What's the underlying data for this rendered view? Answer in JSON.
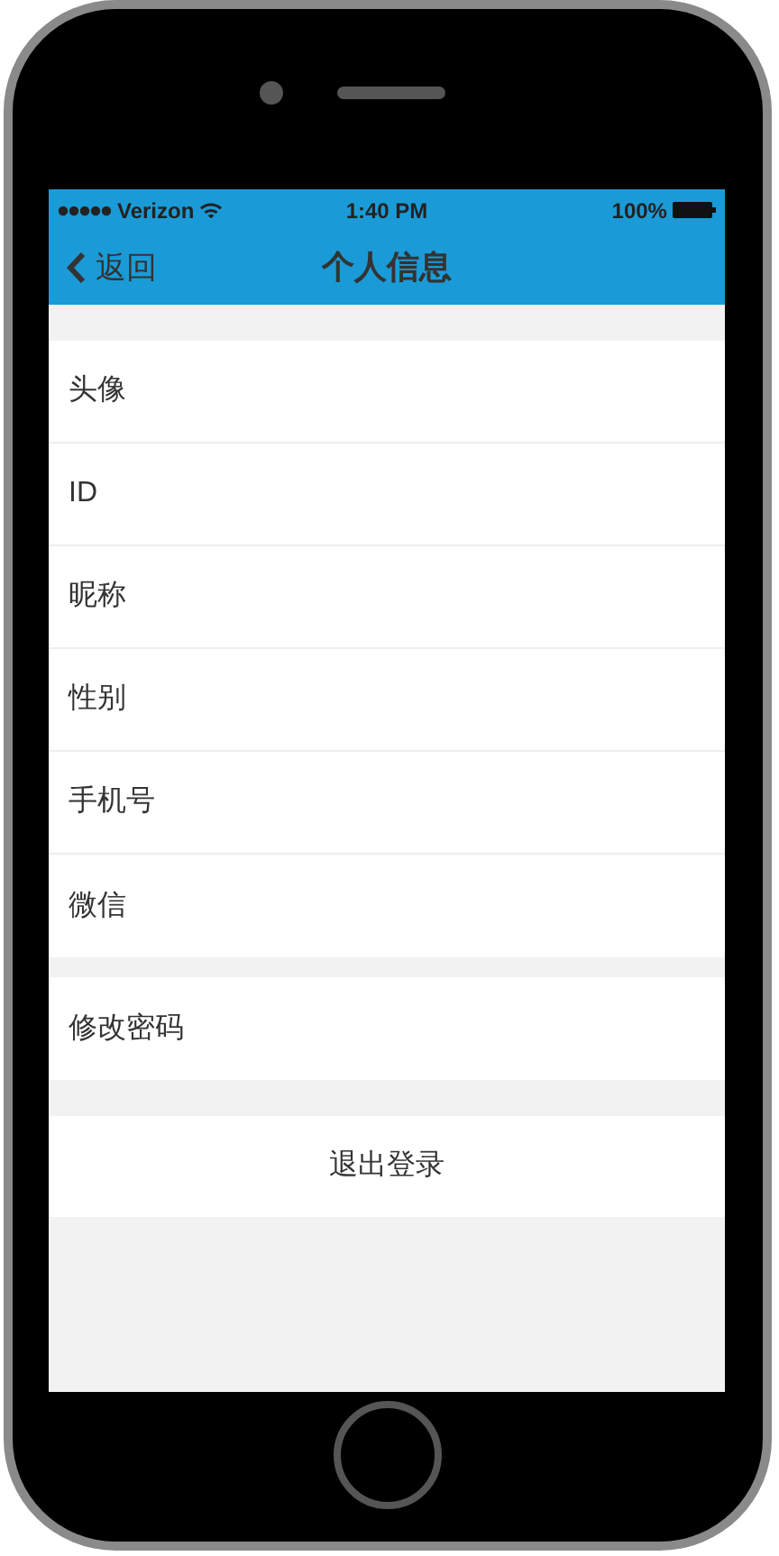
{
  "status_bar": {
    "carrier": "Verizon",
    "time": "1:40 PM",
    "battery": "100%"
  },
  "nav_bar": {
    "back": "返回",
    "title": "个人信息"
  },
  "groups": [
    {
      "items": [
        {
          "label": "头像"
        },
        {
          "label": "ID"
        },
        {
          "label": "昵称"
        },
        {
          "label": "性别"
        },
        {
          "label": "手机号"
        },
        {
          "label": "微信"
        }
      ]
    },
    {
      "items": [
        {
          "label": "修改密码"
        }
      ]
    }
  ],
  "logout_button": "退出登录"
}
